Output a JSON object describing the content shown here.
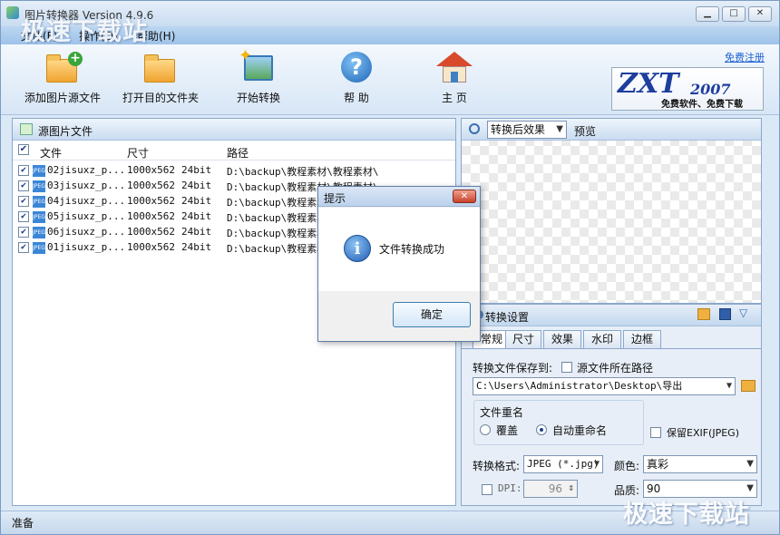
{
  "window": {
    "title": "图片转换器 Version 4.9.6",
    "watermark": "极速下载站"
  },
  "menu": [
    {
      "label": "文件(F)"
    },
    {
      "label": "操作(O)"
    },
    {
      "label": "帮助(H)"
    }
  ],
  "toolbar": [
    {
      "label": "添加图片源文件",
      "icon": "add-folder-icon"
    },
    {
      "label": "打开目的文件夹",
      "icon": "folder-icon"
    },
    {
      "label": "开始转换",
      "icon": "magic-wand-icon"
    },
    {
      "label": "帮 助",
      "icon": "help-icon"
    },
    {
      "label": "主 页",
      "icon": "home-icon"
    }
  ],
  "logo": {
    "main": "ZXT",
    "year": "2007",
    "slogan": "免费软件、免费下载",
    "register_link": "免费注册"
  },
  "source_panel": {
    "title": "源图片文件",
    "columns": [
      "文件",
      "尺寸",
      "路径"
    ],
    "rows": [
      {
        "checked": true,
        "name": "02jisuxz_p...",
        "size": "1000x562",
        "depth": "24bit",
        "path": "D:\\backup\\教程素材\\教程素材\\"
      },
      {
        "checked": true,
        "name": "03jisuxz_p...",
        "size": "1000x562",
        "depth": "24bit",
        "path": "D:\\backup\\教程素材\\教程素材\\"
      },
      {
        "checked": true,
        "name": "04jisuxz_p...",
        "size": "1000x562",
        "depth": "24bit",
        "path": "D:\\backup\\教程素材\\"
      },
      {
        "checked": true,
        "name": "05jisuxz_p...",
        "size": "1000x562",
        "depth": "24bit",
        "path": "D:\\backup\\教程素材\\"
      },
      {
        "checked": true,
        "name": "06jisuxz_p...",
        "size": "1000x562",
        "depth": "24bit",
        "path": "D:\\backup\\教程素材\\"
      },
      {
        "checked": true,
        "name": "01jisuxz_p...",
        "size": "1000x562",
        "depth": "24bit",
        "path": "D:\\backup\\教程素材\\"
      }
    ]
  },
  "preview_panel": {
    "mode_select": "转换后效果",
    "label": "预览"
  },
  "settings_panel": {
    "title": "转换设置",
    "tabs": [
      "常规",
      "尺寸",
      "效果",
      "水印",
      "边框"
    ],
    "save_to_label": "转换文件保存到:",
    "source_path_checkbox": "源文件所在路径",
    "save_path": "C:\\Users\\Administrator\\Desktop\\导出",
    "rename_group": "文件重名",
    "overwrite_label": "覆盖",
    "auto_rename_label": "自动重命名",
    "keep_exif_label": "保留EXIF(JPEG)",
    "format_label": "转换格式:",
    "format_value": "JPEG (*.jpg)",
    "color_label": "颜色:",
    "color_value": "真彩",
    "dpi_label": "DPI:",
    "dpi_value": "96",
    "quality_label": "品质:",
    "quality_value": "90"
  },
  "status": {
    "text": "准备"
  },
  "dialog": {
    "title": "提示",
    "message": "文件转换成功",
    "ok_button": "确定"
  }
}
